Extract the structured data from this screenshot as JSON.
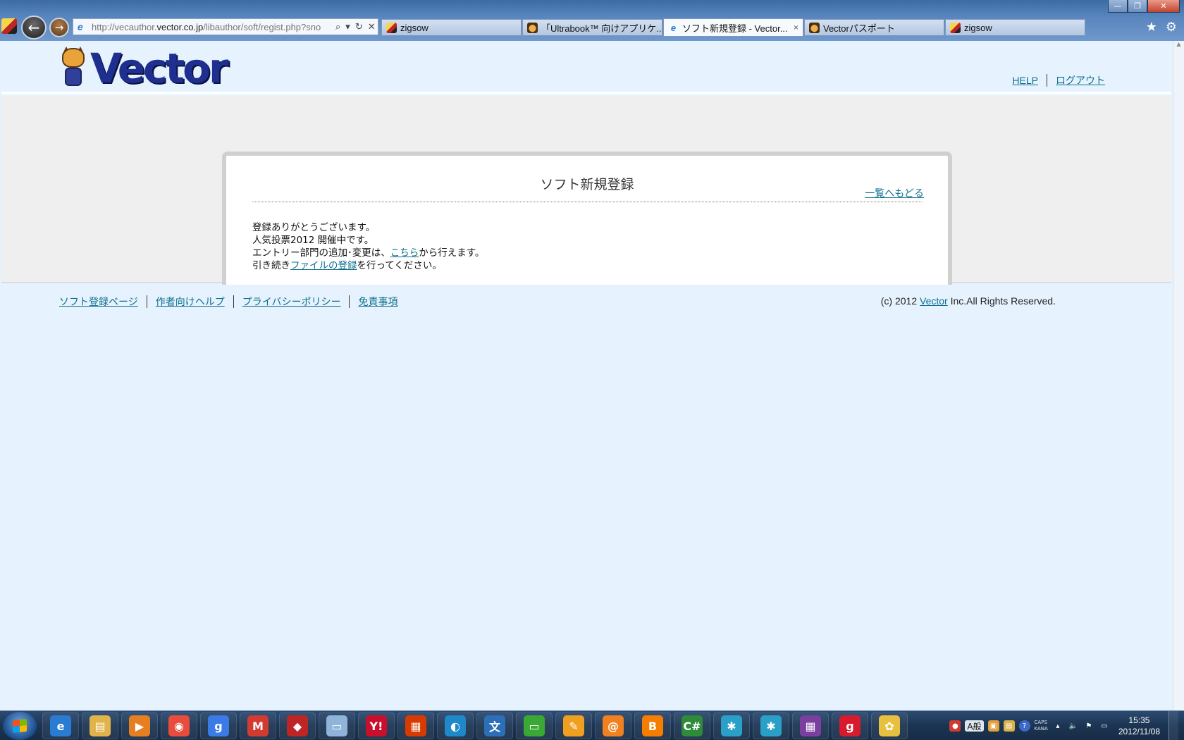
{
  "browser": {
    "address": {
      "prefix": "http://vecauthor.",
      "domain": "vector.co.jp",
      "path": "/libauthor/soft/regist.php?sno"
    },
    "tabs": [
      {
        "label": "zigsow",
        "icon": "zigsow-favicon",
        "active": false
      },
      {
        "label": "「Ultrabook™ 向けアプリケ...",
        "icon": "vector-cat-favicon",
        "active": false
      },
      {
        "label": "ソフト新規登録 - Vector...",
        "icon": "ie-favicon",
        "active": true,
        "close": "×"
      },
      {
        "label": "Vectorパスポート",
        "icon": "vector-cat-favicon",
        "active": false
      },
      {
        "label": "zigsow",
        "icon": "zigsow-favicon",
        "active": false
      }
    ],
    "window_buttons": {
      "minimize": "—",
      "restore": "❐",
      "close": "✕"
    },
    "nav": {
      "back": "←",
      "forward": "→"
    },
    "toolbar_right": {
      "favorites": "★",
      "tools": "⚙"
    }
  },
  "header": {
    "logo_text": "Vector",
    "links": {
      "help": "HELP",
      "logout": "ログアウト"
    }
  },
  "card": {
    "title": "ソフト新規登録",
    "back_link": "一覧へもどる",
    "line1": "登録ありがとうございます。",
    "line2": "人気投票2012 開催中です。",
    "line3_pre": "エントリー部門の追加･変更は、",
    "line3_link": "こちら",
    "line3_post": "から行えます。",
    "line4_pre": "引き続き",
    "line4_link": "ファイルの登録",
    "line4_post": "を行ってください。"
  },
  "footer": {
    "links": [
      "ソフト登録ページ",
      "作者向けヘルプ",
      "プライバシーポリシー",
      "免責事項"
    ],
    "copyright_pre": "(c) 2012 ",
    "copyright_link": "Vector",
    "copyright_post": " Inc.All Rights Reserved."
  },
  "taskbar": {
    "apps": [
      {
        "name": "ie",
        "glyph": "e",
        "color": "#2a7cd3"
      },
      {
        "name": "explorer",
        "glyph": "▤",
        "color": "#e0b44a"
      },
      {
        "name": "media-player",
        "glyph": "▶",
        "color": "#e67e22"
      },
      {
        "name": "chrome",
        "glyph": "◉",
        "color": "#e74c3c"
      },
      {
        "name": "google",
        "glyph": "g",
        "color": "#3b7be8"
      },
      {
        "name": "gmail",
        "glyph": "M",
        "color": "#d23c30"
      },
      {
        "name": "zigsow",
        "glyph": "◆",
        "color": "#c02525"
      },
      {
        "name": "notepad",
        "glyph": "▭",
        "color": "#8fb3d9"
      },
      {
        "name": "yahoo",
        "glyph": "Y!",
        "color": "#c8102e"
      },
      {
        "name": "office",
        "glyph": "▦",
        "color": "#d83b01"
      },
      {
        "name": "browser-app",
        "glyph": "◐",
        "color": "#1e88c8"
      },
      {
        "name": "translate",
        "glyph": "文",
        "color": "#2c6fb8"
      },
      {
        "name": "green-app",
        "glyph": "▭",
        "color": "#3aa835"
      },
      {
        "name": "pin-app",
        "glyph": "✎",
        "color": "#f0a020"
      },
      {
        "name": "at-app",
        "glyph": "@",
        "color": "#f08020"
      },
      {
        "name": "blogger",
        "glyph": "B",
        "color": "#f57d00"
      },
      {
        "name": "csharp",
        "glyph": "C#",
        "color": "#2f8a3a"
      },
      {
        "name": "paw-app-1",
        "glyph": "✱",
        "color": "#2a9fc8"
      },
      {
        "name": "paw-app-2",
        "glyph": "✱",
        "color": "#2a9fc8"
      },
      {
        "name": "windows8",
        "glyph": "▦",
        "color": "#7b3fa0"
      },
      {
        "name": "g-app",
        "glyph": "g",
        "color": "#d81b2c"
      },
      {
        "name": "paint",
        "glyph": "✿",
        "color": "#e8c040"
      }
    ],
    "ime": "A般",
    "caps": "CAPS",
    "kana": "KANA",
    "time": "15:35",
    "date": "2012/11/08"
  }
}
